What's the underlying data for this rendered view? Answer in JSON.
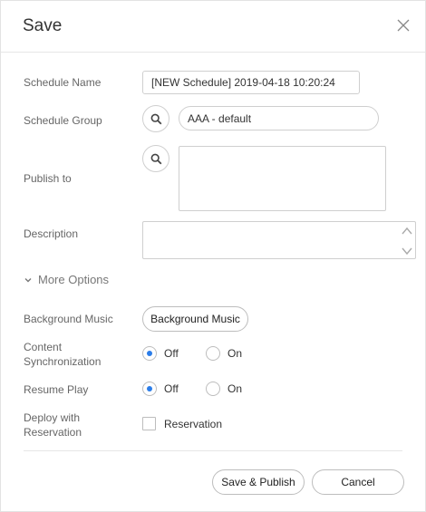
{
  "dialog": {
    "title": "Save"
  },
  "form": {
    "schedule_name": {
      "label": "Schedule Name",
      "value": "[NEW Schedule] 2019-04-18 10:20:24"
    },
    "schedule_group": {
      "label": "Schedule Group",
      "value": "AAA - default"
    },
    "publish_to": {
      "label": "Publish to",
      "value": ""
    },
    "description": {
      "label": "Description",
      "value": ""
    }
  },
  "more_options": {
    "label": "More Options"
  },
  "options": {
    "background_music": {
      "label": "Background Music",
      "button_label": "Background Music"
    },
    "content_sync": {
      "label_line1": "Content",
      "label_line2": "Synchronization",
      "off_label": "Off",
      "on_label": "On",
      "selected": "Off"
    },
    "resume_play": {
      "label": "Resume Play",
      "off_label": "Off",
      "on_label": "On",
      "selected": "Off"
    },
    "deploy": {
      "label_line1": "Deploy with",
      "label_line2": "Reservation",
      "checkbox_label": "Reservation",
      "checked": false
    }
  },
  "footer": {
    "save_publish_label": "Save & Publish",
    "cancel_label": "Cancel"
  },
  "colors": {
    "radio_selected": "#2b7de9"
  },
  "icons": {
    "close": "close-icon",
    "search": "search-icon",
    "chevron": "chevron-down-icon"
  }
}
